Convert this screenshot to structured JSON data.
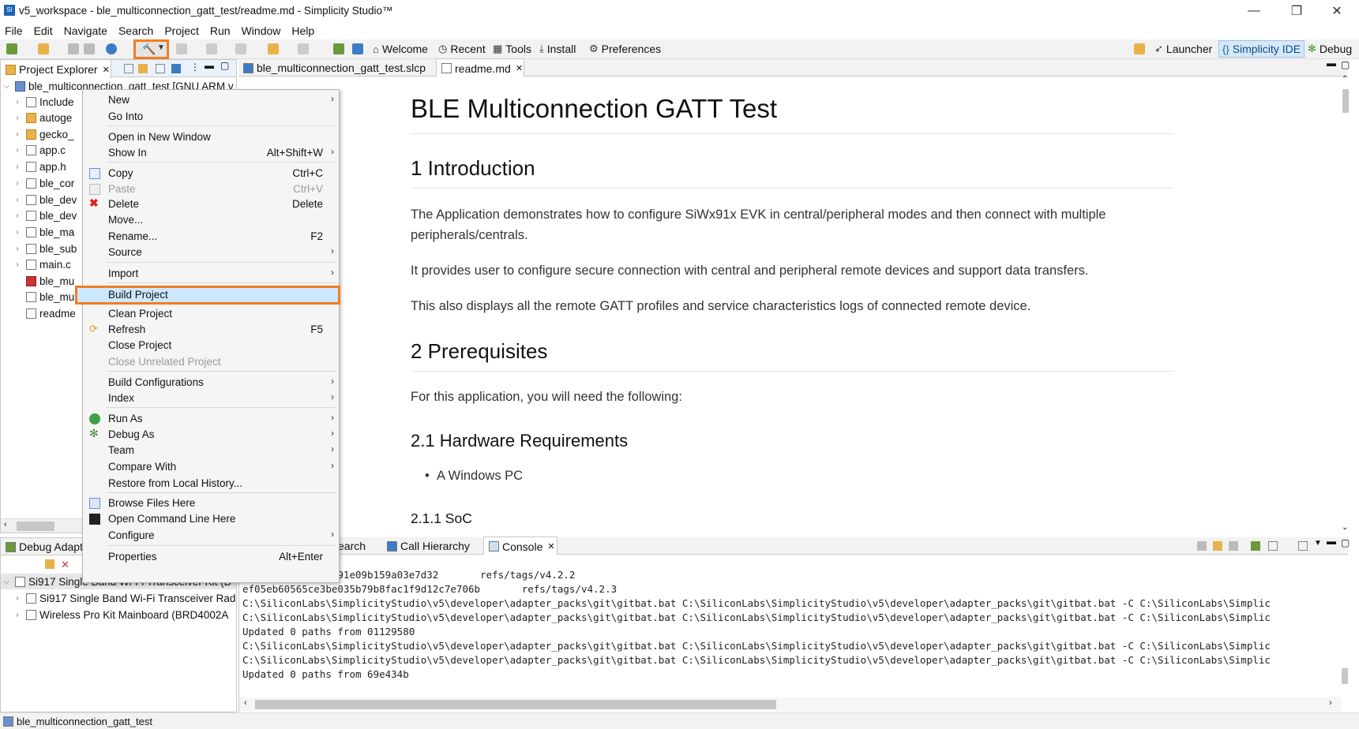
{
  "window": {
    "title": "v5_workspace - ble_multiconnection_gatt_test/readme.md - Simplicity Studio™",
    "minimize": "—",
    "restore": "❐",
    "close": "✕"
  },
  "menubar": [
    "File",
    "Edit",
    "Navigate",
    "Search",
    "Project",
    "Run",
    "Window",
    "Help"
  ],
  "toolbar": {
    "welcome": "Welcome",
    "recent": "Recent",
    "tools": "Tools",
    "install": "Install",
    "preferences": "Preferences",
    "launcher": "Launcher",
    "simplicity_ide": "Simplicity IDE",
    "debug": "Debug"
  },
  "project_explorer": {
    "tab": "Project Explorer",
    "root": "ble_multiconnection_gatt_test [GNU ARM v",
    "items": [
      "Include",
      "autoge",
      "gecko_",
      "app.c",
      "app.h",
      "ble_cor",
      "ble_dev",
      "ble_dev",
      "ble_ma",
      "ble_sub",
      "main.c",
      "ble_mu",
      "ble_mu",
      "readme"
    ]
  },
  "context_menu": {
    "items": [
      {
        "label": "New",
        "accel": "",
        "submenu": true,
        "disabled": false
      },
      {
        "label": "Go Into",
        "accel": "",
        "submenu": false,
        "disabled": false
      },
      {
        "label": "Open in New Window",
        "accel": "",
        "submenu": false,
        "disabled": false
      },
      {
        "label": "Show In",
        "accel": "Alt+Shift+W",
        "submenu": true,
        "disabled": false
      },
      {
        "label": "Copy",
        "accel": "Ctrl+C",
        "submenu": false,
        "disabled": false
      },
      {
        "label": "Paste",
        "accel": "Ctrl+V",
        "submenu": false,
        "disabled": true
      },
      {
        "label": "Delete",
        "accel": "Delete",
        "submenu": false,
        "disabled": false
      },
      {
        "label": "Move...",
        "accel": "",
        "submenu": false,
        "disabled": false
      },
      {
        "label": "Rename...",
        "accel": "F2",
        "submenu": false,
        "disabled": false
      },
      {
        "label": "Source",
        "accel": "",
        "submenu": true,
        "disabled": false
      },
      {
        "label": "Import",
        "accel": "",
        "submenu": true,
        "disabled": false
      },
      {
        "label": "Build Project",
        "accel": "",
        "submenu": false,
        "disabled": false
      },
      {
        "label": "Clean Project",
        "accel": "",
        "submenu": false,
        "disabled": false
      },
      {
        "label": "Refresh",
        "accel": "F5",
        "submenu": false,
        "disabled": false
      },
      {
        "label": "Close Project",
        "accel": "",
        "submenu": false,
        "disabled": false
      },
      {
        "label": "Close Unrelated Project",
        "accel": "",
        "submenu": false,
        "disabled": true
      },
      {
        "label": "Build Configurations",
        "accel": "",
        "submenu": true,
        "disabled": false
      },
      {
        "label": "Index",
        "accel": "",
        "submenu": true,
        "disabled": false
      },
      {
        "label": "Run As",
        "accel": "",
        "submenu": true,
        "disabled": false
      },
      {
        "label": "Debug As",
        "accel": "",
        "submenu": true,
        "disabled": false
      },
      {
        "label": "Team",
        "accel": "",
        "submenu": true,
        "disabled": false
      },
      {
        "label": "Compare With",
        "accel": "",
        "submenu": true,
        "disabled": false
      },
      {
        "label": "Restore from Local History...",
        "accel": "",
        "submenu": false,
        "disabled": false
      },
      {
        "label": "Browse Files Here",
        "accel": "",
        "submenu": false,
        "disabled": false
      },
      {
        "label": "Open Command Line Here",
        "accel": "",
        "submenu": false,
        "disabled": false
      },
      {
        "label": "Configure",
        "accel": "",
        "submenu": true,
        "disabled": false
      },
      {
        "label": "Properties",
        "accel": "Alt+Enter",
        "submenu": false,
        "disabled": false
      }
    ]
  },
  "editor": {
    "tabs": [
      "ble_multiconnection_gatt_test.slcp",
      "readme.md"
    ],
    "h1": "BLE Multiconnection GATT Test",
    "h2_intro": "1 Introduction",
    "p1": "The Application demonstrates how to configure SiWx91x EVK in central/peripheral modes and then connect with multiple",
    "p1b": "peripherals/centrals.",
    "p2": "It provides user to configure secure connection with central and peripheral remote devices and support data transfers.",
    "p3": "This also displays all the remote GATT profiles and service characteristics logs of connected remote device.",
    "h2_prereq": "2 Prerequisites",
    "p4": "For this application, you will need the following:",
    "h3_hw": "2.1 Hardware Requirements",
    "li1": "A Windows PC",
    "h4_soc": "2.1.1 SoC"
  },
  "debug_adapters": {
    "tab": "Debug Adapt",
    "items": [
      "Si917 Single Band Wi-Fi Transceiver Kit (B",
      "Si917 Single Band Wi-Fi Transceiver Rad",
      "Wireless Pro Kit Mainboard (BRD4002A"
    ]
  },
  "bottom_tabs": [
    "earch",
    "Call Hierarchy",
    "Console"
  ],
  "console": {
    "lines": [
      "          ac424691e09b159a03e7d32       refs/tags/v4.2.2",
      "ef05eb60565ce3be035b79b8fac1f9d12c7e706b       refs/tags/v4.2.3",
      "C:\\SiliconLabs\\SimplicityStudio\\v5\\developer\\adapter_packs\\git\\gitbat.bat C:\\SiliconLabs\\SimplicityStudio\\v5\\developer\\adapter_packs\\git\\gitbat.bat -C C:\\SiliconLabs\\Simplic",
      "C:\\SiliconLabs\\SimplicityStudio\\v5\\developer\\adapter_packs\\git\\gitbat.bat C:\\SiliconLabs\\SimplicityStudio\\v5\\developer\\adapter_packs\\git\\gitbat.bat -C C:\\SiliconLabs\\Simplic",
      "Updated 0 paths from 01129580",
      "C:\\SiliconLabs\\SimplicityStudio\\v5\\developer\\adapter_packs\\git\\gitbat.bat C:\\SiliconLabs\\SimplicityStudio\\v5\\developer\\adapter_packs\\git\\gitbat.bat -C C:\\SiliconLabs\\Simplic",
      "C:\\SiliconLabs\\SimplicityStudio\\v5\\developer\\adapter_packs\\git\\gitbat.bat C:\\SiliconLabs\\SimplicityStudio\\v5\\developer\\adapter_packs\\git\\gitbat.bat -C C:\\SiliconLabs\\Simplic",
      "Updated 0 paths from 69e434b"
    ]
  },
  "statusbar": {
    "text": "ble_multiconnection_gatt_test"
  },
  "colors": {
    "highlight": "#f47c20",
    "selection": "#cce8ff",
    "accent": "#0a64ad"
  }
}
